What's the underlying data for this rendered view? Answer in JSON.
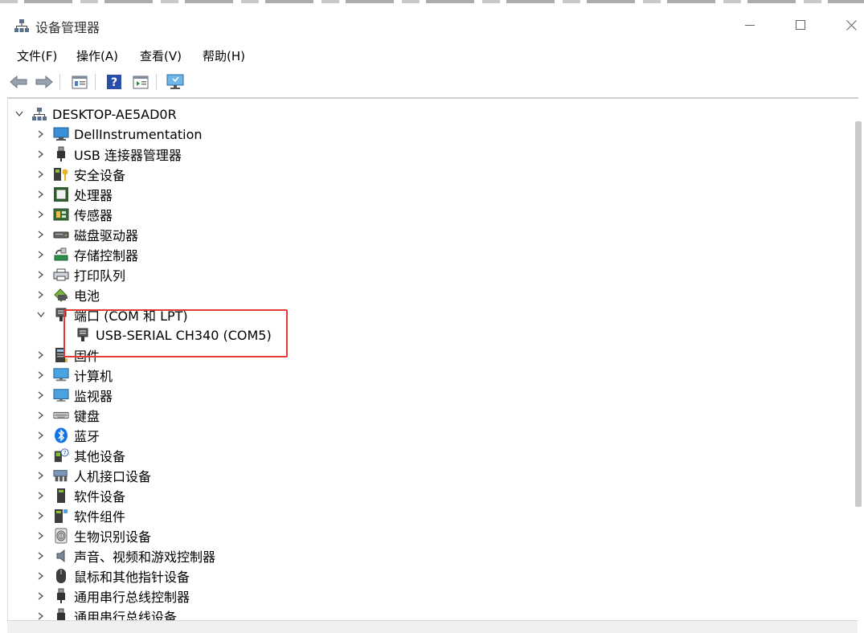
{
  "window": {
    "title": "设备管理器",
    "controls": [
      "—",
      "☐",
      "✕"
    ]
  },
  "menu": [
    "文件(F)",
    "操作(A)",
    "查看(V)",
    "帮助(H)"
  ],
  "toolbar": [
    "back-icon",
    "forward-icon",
    "properties-icon",
    "help-icon",
    "details-icon",
    "monitor-icon"
  ],
  "tree": {
    "root": "DESKTOP-AE5AD0R",
    "categories": [
      {
        "label": "DellInstrumentation",
        "icon": "dell-instrumentation-icon"
      },
      {
        "label": "USB 连接器管理器",
        "icon": "usb-connector-icon"
      },
      {
        "label": "安全设备",
        "icon": "security-device-icon"
      },
      {
        "label": "处理器",
        "icon": "processor-icon"
      },
      {
        "label": "传感器",
        "icon": "sensor-icon"
      },
      {
        "label": "磁盘驱动器",
        "icon": "disk-drive-icon"
      },
      {
        "label": "存储控制器",
        "icon": "storage-controller-icon"
      },
      {
        "label": "打印队列",
        "icon": "print-queue-icon"
      },
      {
        "label": "电池",
        "icon": "battery-icon"
      },
      {
        "label": "端口 (COM 和 LPT)",
        "icon": "port-icon",
        "expanded": true,
        "children": [
          "USB-SERIAL CH340 (COM5)"
        ]
      },
      {
        "label": "固件",
        "icon": "firmware-icon"
      },
      {
        "label": "计算机",
        "icon": "computer-icon"
      },
      {
        "label": "监视器",
        "icon": "monitor-icon"
      },
      {
        "label": "键盘",
        "icon": "keyboard-icon"
      },
      {
        "label": "蓝牙",
        "icon": "bluetooth-icon"
      },
      {
        "label": "其他设备",
        "icon": "other-devices-icon"
      },
      {
        "label": "人机接口设备",
        "icon": "hid-icon"
      },
      {
        "label": "软件设备",
        "icon": "software-device-icon"
      },
      {
        "label": "软件组件",
        "icon": "software-component-icon"
      },
      {
        "label": "生物识别设备",
        "icon": "biometric-icon"
      },
      {
        "label": "声音、视频和游戏控制器",
        "icon": "sound-icon"
      },
      {
        "label": "鼠标和其他指针设备",
        "icon": "mouse-icon"
      },
      {
        "label": "通用串行总线控制器",
        "icon": "usb-controller-icon"
      },
      {
        "label": "通用串行总线设备",
        "icon": "usb-device-icon"
      }
    ]
  },
  "highlight_color": "#e53935"
}
